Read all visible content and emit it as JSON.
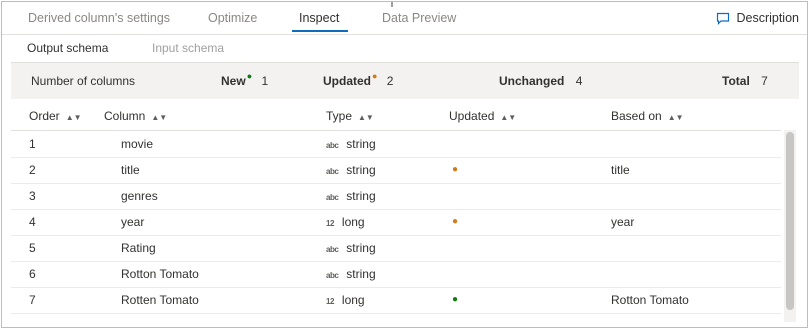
{
  "tabs": [
    {
      "label": "Derived column's settings"
    },
    {
      "label": "Optimize"
    },
    {
      "label": "Inspect"
    },
    {
      "label": "Data Preview"
    }
  ],
  "description_label": "Description",
  "subtabs": [
    {
      "label": "Output schema"
    },
    {
      "label": "Input schema"
    }
  ],
  "summary": {
    "label": "Number of columns",
    "new_label": "New",
    "new_count": "1",
    "updated_label": "Updated",
    "updated_count": "2",
    "unchanged_label": "Unchanged",
    "unchanged_count": "4",
    "total_label": "Total",
    "total_count": "7"
  },
  "columns": [
    "Order",
    "Column",
    "Type",
    "Updated",
    "Based on"
  ],
  "rows": [
    {
      "order": "1",
      "column": "movie",
      "type_icon": "abc",
      "type": "string",
      "updated": "",
      "based_on": ""
    },
    {
      "order": "2",
      "column": "title",
      "type_icon": "abc",
      "type": "string",
      "updated": "orange",
      "based_on": "title"
    },
    {
      "order": "3",
      "column": "genres",
      "type_icon": "abc",
      "type": "string",
      "updated": "",
      "based_on": ""
    },
    {
      "order": "4",
      "column": "year",
      "type_icon": "12",
      "type": "long",
      "updated": "orange",
      "based_on": "year"
    },
    {
      "order": "5",
      "column": "Rating",
      "type_icon": "abc",
      "type": "string",
      "updated": "",
      "based_on": ""
    },
    {
      "order": "6",
      "column": "Rotton Tomato",
      "type_icon": "abc",
      "type": "string",
      "updated": "",
      "based_on": ""
    },
    {
      "order": "7",
      "column": "Rotten Tomato",
      "type_icon": "12",
      "type": "long",
      "updated": "green",
      "based_on": "Rotton Tomato"
    }
  ],
  "colors": {
    "accent": "#0f6cbd",
    "new_marker": "#107c10",
    "updated_marker": "#d07a1c",
    "summary_bg": "#f3f2f1"
  }
}
